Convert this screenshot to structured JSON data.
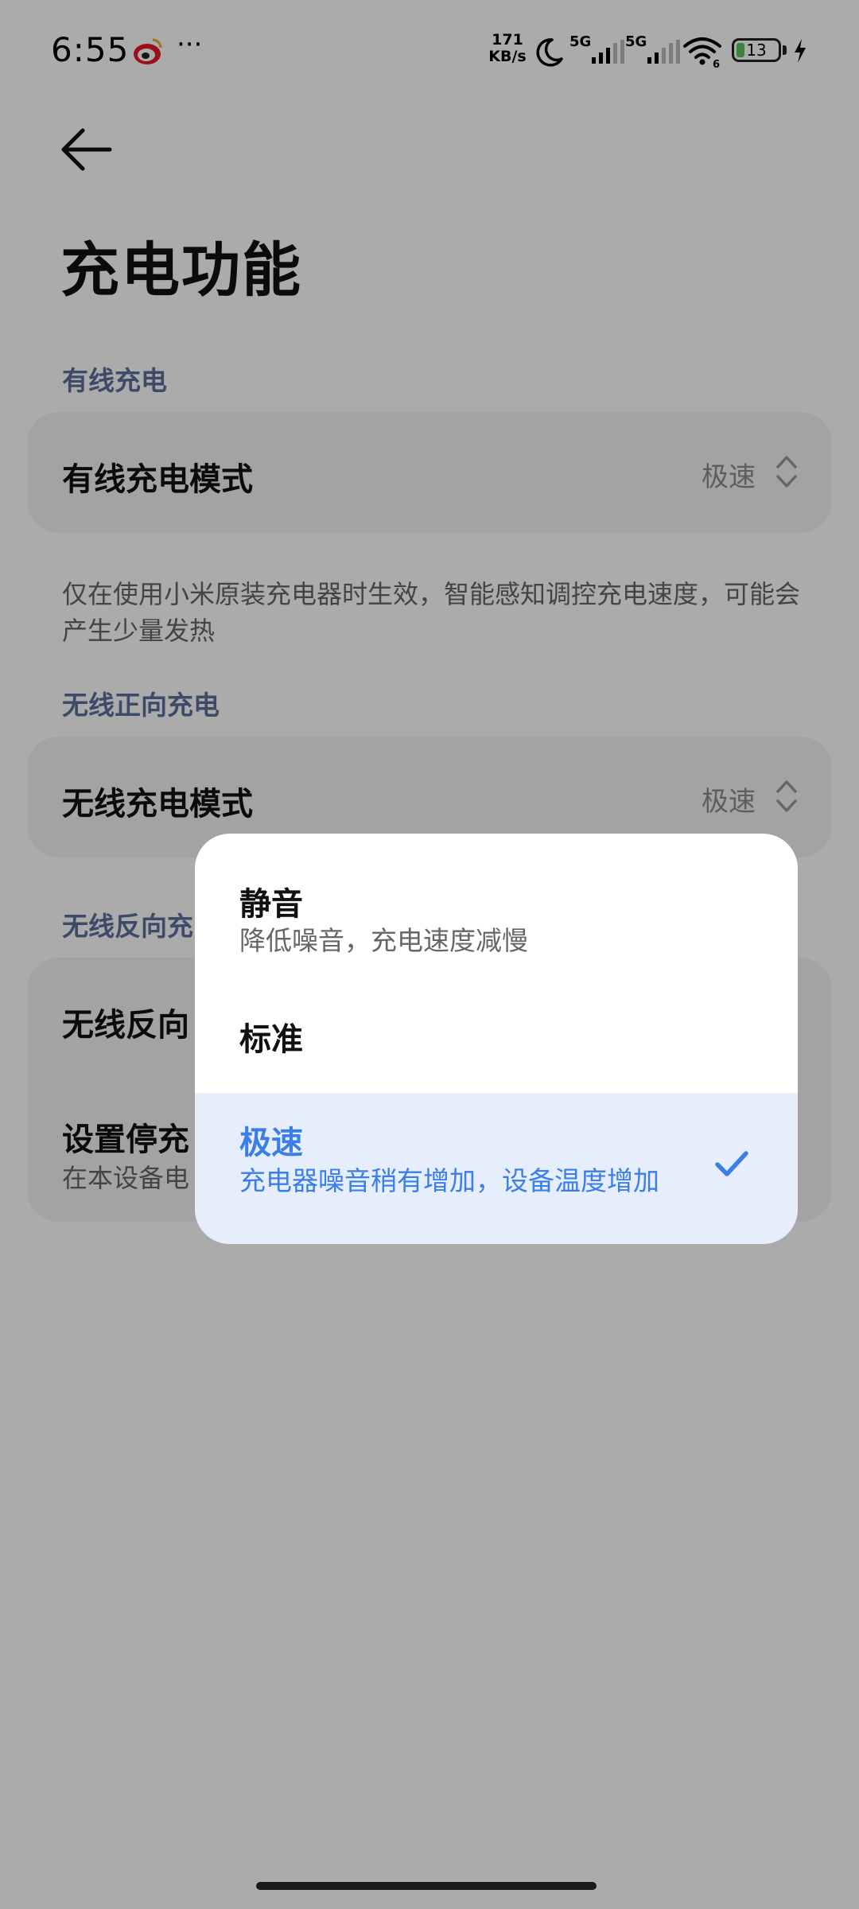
{
  "status_bar": {
    "time": "6:55",
    "more": "···",
    "net_speed_value": "171",
    "net_speed_unit": "KB/s",
    "sim1": "5G",
    "sim2": "5G",
    "wifi_badge": "6",
    "battery_level": "13",
    "battery_fraction": 0.13,
    "icons": [
      "weibo-icon",
      "moon-icon",
      "signal-icon",
      "wifi-icon",
      "battery-icon",
      "charging-icon"
    ]
  },
  "page": {
    "title": "充电功能"
  },
  "sections": {
    "wired": {
      "header": "有线充电",
      "mode_title": "有线充电模式",
      "mode_value": "极速",
      "helper": "仅在使用小米原装充电器时生效，智能感知调控充电速度，可能会产生少量发热"
    },
    "wireless": {
      "header": "无线正向充电",
      "mode_title": "无线充电模式",
      "mode_value": "极速"
    },
    "reverse": {
      "header": "无线反向充",
      "row1_title": "无线反向",
      "row2_title": "设置停充",
      "row2_sub": "在本设备电"
    }
  },
  "popup": {
    "options": [
      {
        "title": "静音",
        "desc": "降低噪音，充电速度减慢"
      },
      {
        "title": "标准",
        "desc": ""
      },
      {
        "title": "极速",
        "desc": "充电器噪音稍有增加，设备温度增加"
      }
    ],
    "selected_index": 2
  },
  "colors": {
    "accent": "#3a7ee6",
    "section_header": "#5c6f9c",
    "card_bg": "#f4f4f6",
    "selected_bg": "#e6eefb"
  }
}
